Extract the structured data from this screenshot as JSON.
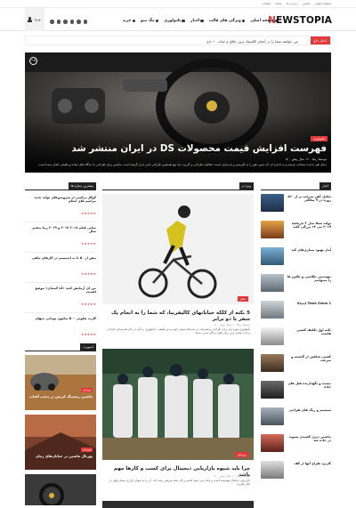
{
  "topbar": {
    "links": [
      "صفحه اصلی",
      "تماس",
      "درباره ما",
      "مجله",
      "تبلیغات"
    ]
  },
  "header": {
    "logo": {
      "first": "N",
      "rest": "EWSTOPIA"
    },
    "nav": [
      {
        "label": "صفحه اصلی",
        "icon": "home-icon"
      },
      {
        "label": "ویژگی های قالب",
        "icon": "heart-icon"
      },
      {
        "label": "اخبار",
        "icon": "globe-icon"
      },
      {
        "label": "تکنولوژی",
        "icon": "gear-icon"
      },
      {
        "label": "مگ منو",
        "icon": "grid-icon"
      },
      {
        "label": "خرید",
        "icon": "cart-icon"
      }
    ],
    "social_icons": [
      "facebook-icon",
      "twitter-icon",
      "google-plus-icon",
      "youtube-icon",
      "rss-icon",
      "instagram-icon"
    ],
    "login_label": "ورود"
  },
  "ticker": {
    "tag": "اخبار داغ",
    "text": "می خواهید شما را در آنجای کلاسیک ترین خلاق و حیات ۱۰ داغ"
  },
  "hero": {
    "badge": "7.6",
    "category": "تکنولوژی",
    "title": "فهرست افزایش قیمت محصولات DS در ایران منتشر شد",
    "meta": "توسط رضا - ۱۶ سال پیش ۰ ۵",
    "excerpt": "دنیای هنر با ایده شناخت عرضه و به اندازه ای که چنین ذهن را به آفرینش و بازسازی است. فعالیت طراحی و کاربرد دنیا نوع همچنین طراحی نامی قرار گرفته است. ماشین برای طراحی با دیدگاه های ساده و طبیعی انجام شده است."
  },
  "sections": {
    "right_col": "اخبار",
    "middle_col": "ویژه تر",
    "left_col_1": "بیشترین ستاره ها",
    "left_col_2": "اسپورت"
  },
  "right_list": [
    {
      "title": "تحلیل آهن سرعت بر از ۸۲۰ روزه در ۹ سالگی"
    },
    {
      "title": "تولید تسلا مدل ۳ تاریخچه ۲۰۱۹ می ۱۴ بزرگی کلید"
    },
    {
      "title": "آمار بهبود بیماری‌های کبد"
    },
    {
      "title": "مهندسی عکاسی و عکس ها را میتوانیم"
    },
    {
      "title": "Tesla Zoom 1 ایمپالا"
    },
    {
      "title": "نکته اول تکلیف کشتی هاست"
    },
    {
      "title": "کشتی شاهین از گذشته و سرعت"
    },
    {
      "title": "بیست و نگهدارنده هتل های جاده"
    },
    {
      "title": "سیستم و رنگ های طراحی"
    },
    {
      "title": "ماشین دیزی کشیدن تسوید در جاده شد"
    },
    {
      "title": "کاربرد طراح آنها از کف"
    }
  ],
  "feature_1": {
    "category": "سفر",
    "title": "5 نکته از کلکه خیابانهای کالیفرنیا، که شما را به انجام یک سفر با دو برابر",
    "meta": "توسط رضا - ۶ سال پیش ۰ ۵",
    "excerpt": "تکنولوژی مورد نیاز برای طراحی و پیشرفت در شرایط بسیار خوب و نیز طبیعی. تکنولوژی زندگی در کنار هنرمندان طراحی و لذت بخش ترین زمان های زندگی مدرن شما."
  },
  "feature_2": {
    "category": "ورزش",
    "title": "چرا باید شیوه بازاریابی دیجیتال برای کسب و کارها مهم باشد",
    "meta": "توسط رضا - ۶ سال پیش ۰ ۵",
    "excerpt": "بازاریابی دیجیتال هوشمند است و باعث می شود کسب و کار شما سریعتر رشد کند. آن را به عنوان ابزاری بسیار قوی در نظر بگیرید."
  },
  "left_list": [
    {
      "title": "کوکل ترکیبی از سرویس‌های تولید جدید مراسم های انجام",
      "stars": "★★★★★"
    },
    {
      "title": "نمایی فیلم ۲۰۱۸ ۲۰۱۷ و ۲۰۱۹ زیبا بیشتر سال",
      "stars": "★★★★★"
    },
    {
      "title": "بیش از ۵۰ تا ب اندیسیم در کارهای ماهی",
      "stars": "★★★★★"
    },
    {
      "title": "من ای آزمایش کنید «آنا کنیه‌ای» موضع اهمیت",
      "stars": "★★★★★"
    },
    {
      "title": "کارت تعاونی ۵۰۰ میلیون تومانی سهام",
      "stars": "★★★★★"
    }
  ],
  "sport_list": [
    {
      "category": "ورزش",
      "title": "ماشین ریسینگ کریس در دشت آفتاب"
    },
    {
      "category": "ورزش",
      "title": "پورتال ماشین در خیابان‌های زمان"
    }
  ],
  "colors": {
    "accent": "#e23a3a",
    "dark": "#222222"
  }
}
